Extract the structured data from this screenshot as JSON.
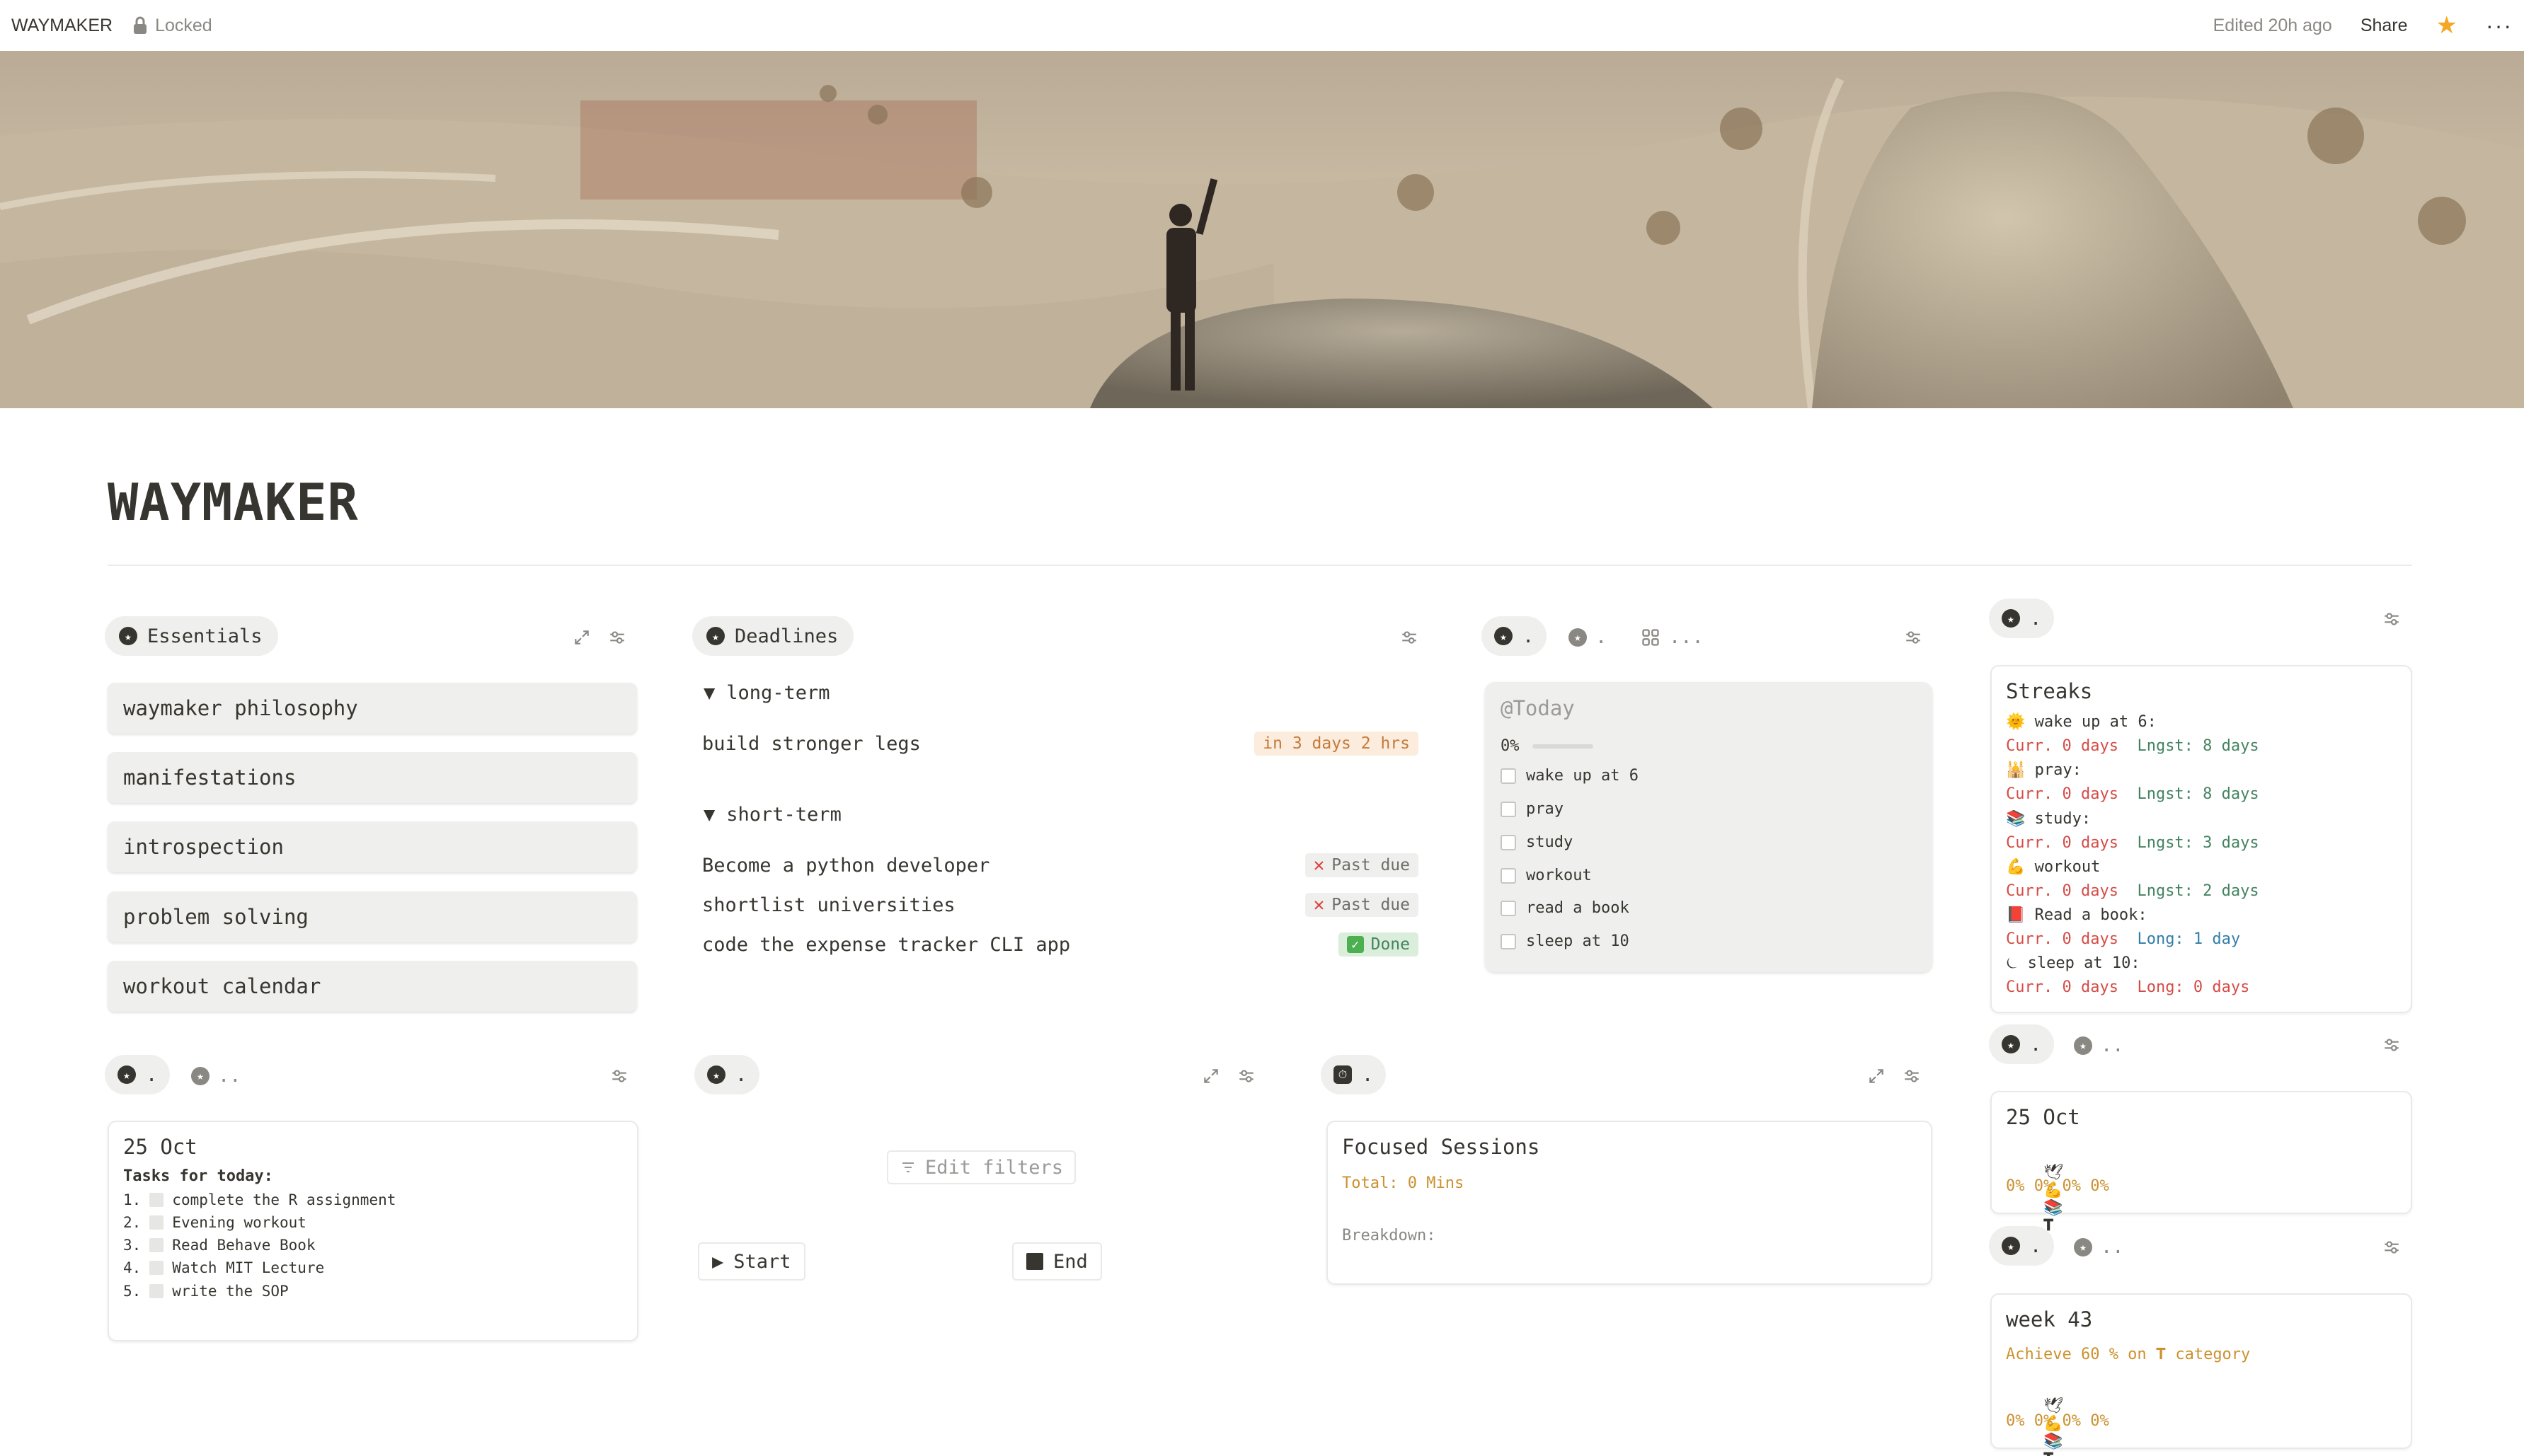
{
  "topbar": {
    "title": "WAYMAKER",
    "locked": "Locked",
    "edited": "Edited 20h ago",
    "share": "Share",
    "star_icon": "star-icon",
    "more": "···"
  },
  "page": {
    "title": "WAYMAKER"
  },
  "essentials": {
    "label": "Essentials",
    "items": [
      "waymaker philosophy",
      "manifestations",
      "introspection",
      "problem solving",
      "workout calendar"
    ]
  },
  "deadlines": {
    "label": "Deadlines",
    "groups": [
      {
        "name": "long-term",
        "toggle": "▼",
        "rows": [
          {
            "task": "build stronger legs",
            "status": "in 3 days 2 hrs"
          }
        ]
      },
      {
        "name": "short-term",
        "toggle": "▼",
        "rows": [
          {
            "task": "Become a python developer",
            "status": "Past due"
          },
          {
            "task": "shortlist universities",
            "status": "Past due"
          },
          {
            "task": "code the expense tracker CLI app",
            "status": "Done"
          }
        ]
      }
    ]
  },
  "today_view": {
    "tab1": ".",
    "tab2": ".",
    "tab3": "...",
    "header": "@Today",
    "progress_text": "0%",
    "progress": 0,
    "todos": [
      "wake up at 6",
      "pray",
      "study",
      "workout",
      "read a book",
      "sleep at 10"
    ]
  },
  "streaks_view": {
    "tab1": ".",
    "title": "Streaks",
    "items": [
      {
        "emoji": "🌞",
        "habit": "wake up at 6:",
        "curr": "Curr. 0 days",
        "best": "Lngst: 8 days",
        "best_color": "green"
      },
      {
        "emoji": "🕌",
        "habit": "pray:",
        "curr": "Curr. 0 days",
        "best": "Lngst: 8 days",
        "best_color": "green"
      },
      {
        "emoji": "📚",
        "habit": "study:",
        "curr": "Curr. 0 days",
        "best": "Lngst: 3 days",
        "best_color": "green"
      },
      {
        "emoji": "💪",
        "habit": "workout",
        "curr": "Curr. 0 days",
        "best": "Lngst: 2 days",
        "best_color": "green"
      },
      {
        "emoji": "📕",
        "habit": "Read a book:",
        "curr": "Curr. 0 days",
        "best": "Long: 1 day",
        "best_color": "blue"
      },
      {
        "emoji": "⏾",
        "habit": "sleep at 10:",
        "curr": "Curr. 0 days",
        "best": "Long: 0 days",
        "best_color": "red"
      }
    ]
  },
  "daily_view": {
    "tab1": ".",
    "tab2": "..",
    "date": "25 Oct",
    "tasks_header": "Tasks for today:",
    "tasks": [
      {
        "num": "1.",
        "text": "complete the R assignment"
      },
      {
        "num": "2.",
        "text": "Evening workout"
      },
      {
        "num": "3.",
        "text": "Read Behave Book"
      },
      {
        "num": "4.",
        "text": "Watch MIT Lecture"
      },
      {
        "num": "5.",
        "text": "write the SOP"
      }
    ]
  },
  "timer_view": {
    "tab1": ".",
    "edit_filters": "Edit filters",
    "start": "Start",
    "end": "End"
  },
  "sessions_view": {
    "tab1": ".",
    "title": "Focused Sessions",
    "total": "Total: 0 Mins",
    "breakdown": "Breakdown:"
  },
  "daily_score_view": {
    "tab1": ".",
    "tab2": "..",
    "date": "25 Oct",
    "icons": [
      "🕊",
      "💪",
      "📚",
      "𝐓"
    ],
    "scores": "0% 0% 0% 0%"
  },
  "weekly_view": {
    "tab1": ".",
    "tab2": "..",
    "week": "week 43",
    "goal": "Achieve 60 % on 𝐓 category",
    "icons": [
      "🕊",
      "💪",
      "📚",
      "𝐓"
    ],
    "scores": "0% 0% 0% 0%"
  },
  "colors": {
    "text": "#37352f",
    "muted": "#8a8883",
    "red": "#d44c47",
    "green": "#448361",
    "blue": "#337ea9",
    "orange": "#cb912f",
    "star": "#f5a623"
  }
}
